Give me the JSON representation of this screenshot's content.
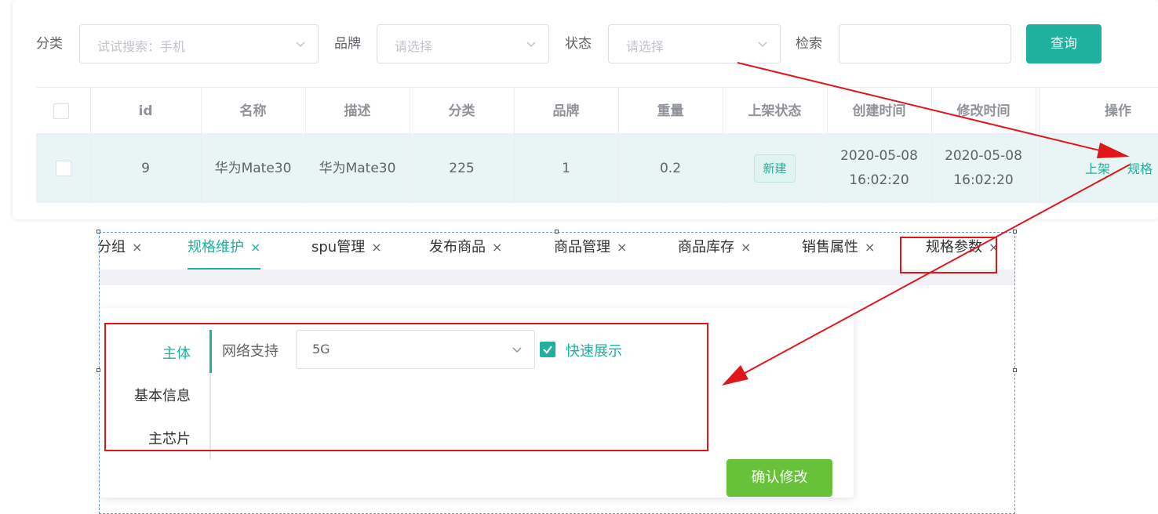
{
  "filters": {
    "category_label": "分类",
    "category_placeholder": "试试搜索：手机",
    "brand_label": "品牌",
    "brand_placeholder": "请选择",
    "status_label": "状态",
    "status_placeholder": "请选择",
    "search_label": "检索",
    "search_value": "",
    "query_button": "查询"
  },
  "table": {
    "headers": [
      "id",
      "名称",
      "描述",
      "分类",
      "品牌",
      "重量",
      "上架状态",
      "创建时间",
      "修改时间",
      "操作"
    ],
    "rows": [
      {
        "id": "9",
        "name": "华为Mate30",
        "desc": "华为Mate30",
        "category": "225",
        "brand": "1",
        "weight": "0.2",
        "status_tag": "新建",
        "created_date": "2020-05-08",
        "created_time": "16:02:20",
        "modified_date": "2020-05-08",
        "modified_time": "16:02:20",
        "op_shelve": "上架",
        "op_spec": "规格"
      }
    ]
  },
  "tabs": [
    {
      "label": "分组"
    },
    {
      "label": "规格维护",
      "active": true
    },
    {
      "label": "spu管理"
    },
    {
      "label": "发布商品"
    },
    {
      "label": "商品管理"
    },
    {
      "label": "商品库存"
    },
    {
      "label": "销售属性"
    },
    {
      "label": "规格参数"
    }
  ],
  "tab_close_glyph": "×",
  "spec_panel": {
    "groups": [
      {
        "label": "主体",
        "active": true
      },
      {
        "label": "基本信息"
      },
      {
        "label": "主芯片"
      }
    ],
    "field_label": "网络支持",
    "field_value": "5G",
    "quick_show_label": "快速展示",
    "quick_show_checked": true,
    "confirm_button": "确认修改"
  },
  "colors": {
    "primary": "#1fb19e",
    "confirm": "#67c23a",
    "annotation_red": "#e0161b",
    "row_highlight": "#e8f5f4"
  }
}
